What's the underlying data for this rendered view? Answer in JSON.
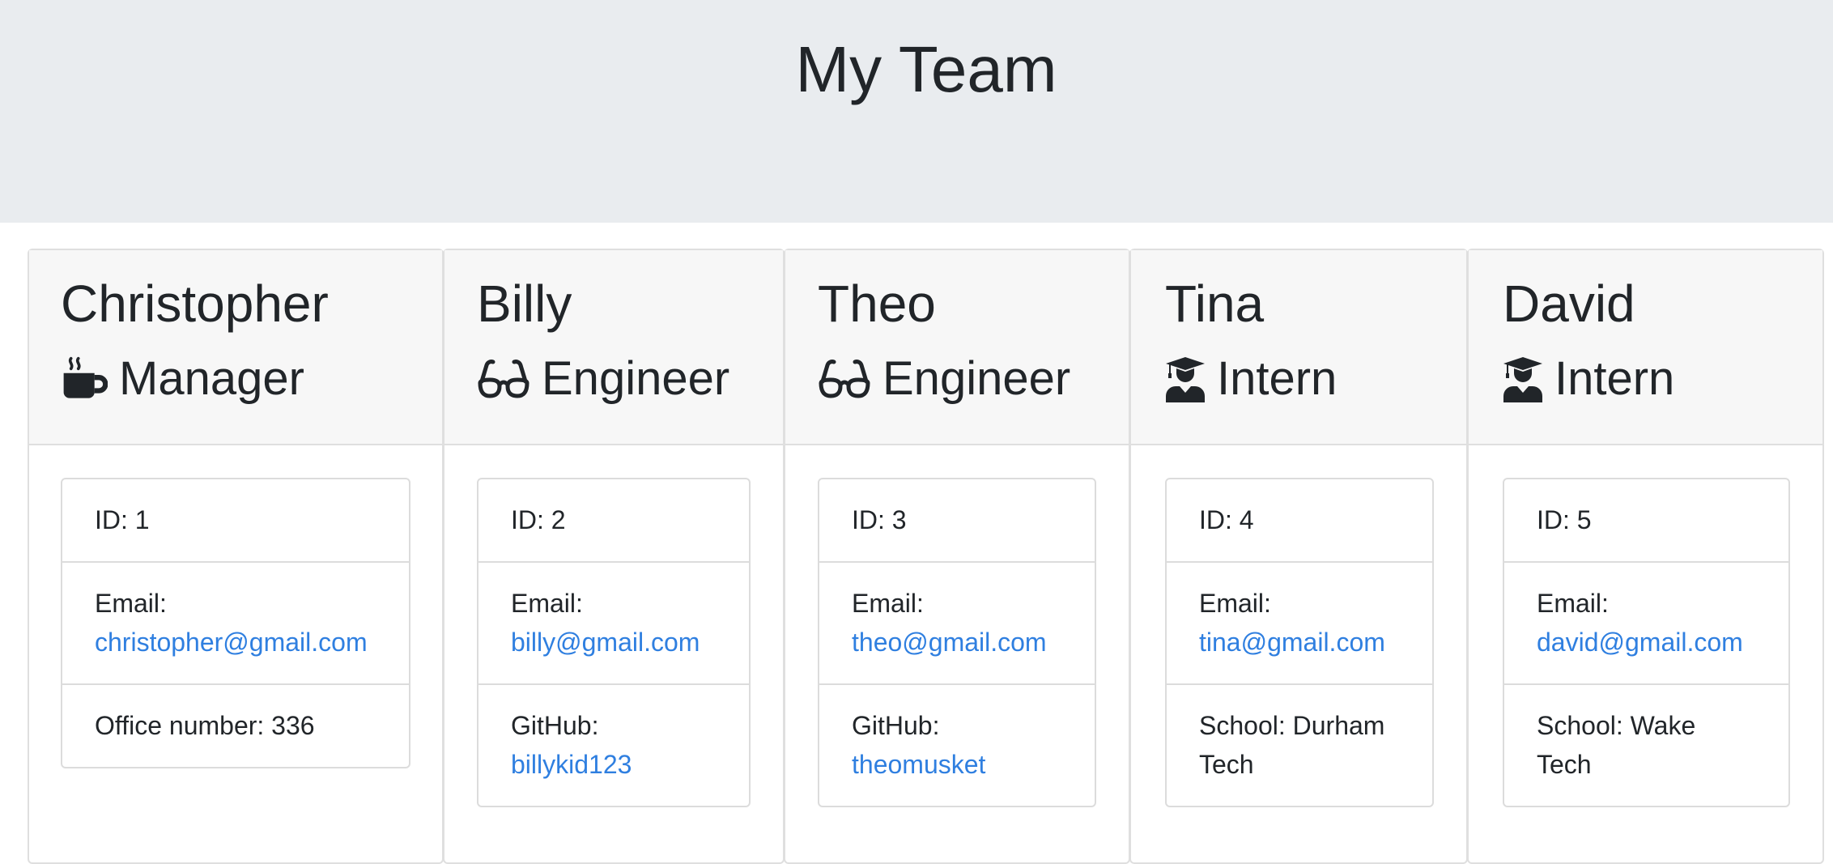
{
  "title": "My Team",
  "members": [
    {
      "name": "Christopher",
      "role": "Manager",
      "icon": "coffee-icon",
      "id_text": "ID: 1",
      "email_label": "Email:",
      "email": "christopher@gmail.com",
      "extra_label": "Office number: 336",
      "extra_value": ""
    },
    {
      "name": "Billy",
      "role": "Engineer",
      "icon": "glasses-icon",
      "id_text": "ID: 2",
      "email_label": "Email:",
      "email": "billy@gmail.com",
      "extra_label": "GitHub:",
      "extra_value": "billykid123"
    },
    {
      "name": "Theo",
      "role": "Engineer",
      "icon": "glasses-icon",
      "id_text": "ID: 3",
      "email_label": "Email:",
      "email": "theo@gmail.com",
      "extra_label": "GitHub:",
      "extra_value": "theomusket"
    },
    {
      "name": "Tina",
      "role": "Intern",
      "icon": "graduate-icon",
      "id_text": "ID: 4",
      "email_label": "Email:",
      "email": "tina@gmail.com",
      "extra_label": "School: Durham Tech",
      "extra_value": ""
    },
    {
      "name": "David",
      "role": "Intern",
      "icon": "graduate-icon",
      "id_text": "ID: 5",
      "email_label": "Email:",
      "email": "david@gmail.com",
      "extra_label": "School: Wake Tech",
      "extra_value": ""
    }
  ],
  "colors": {
    "header_bg": "#e9ecef",
    "card_header_bg": "#f7f7f7",
    "link": "#2f7fe0",
    "text": "#212529"
  }
}
